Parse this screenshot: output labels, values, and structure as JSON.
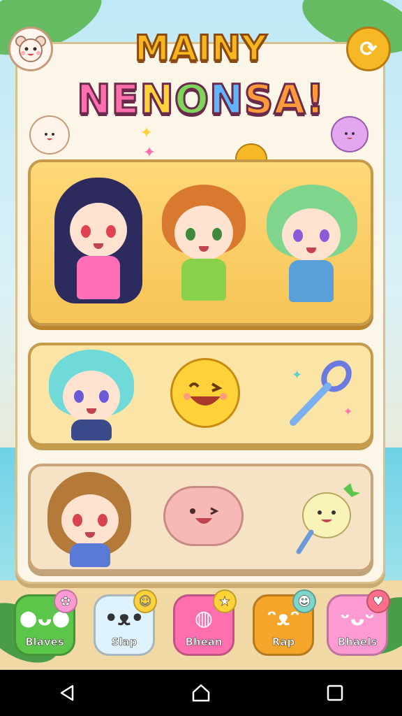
{
  "title": {
    "line1": "MAINY",
    "line2_parts": [
      "NE",
      "N",
      "O",
      "N",
      "SA!"
    ]
  },
  "corner": {
    "left_icon": "bear-face-icon",
    "right_icon": "refresh-icon",
    "right_glyph": "⟳"
  },
  "cards": [
    {
      "name": "character-trio-card",
      "characters": [
        {
          "hair": "#2d2a5e",
          "outfit": "#ff6fb8",
          "eye": "#e0434f"
        },
        {
          "hair": "#d9782f",
          "outfit": "#8ad14b",
          "eye": "#3f8a3a"
        },
        {
          "hair": "#7fd58c",
          "outfit": "#5aa0d8",
          "eye": "#8a5ad8"
        }
      ]
    },
    {
      "name": "character-emoji-card",
      "character": {
        "hair": "#6fdad8",
        "outfit": "#3a4a8a",
        "eye": "#6a5ad8"
      },
      "emoji_icon": "laughing-face-icon",
      "tool_icon": "magic-wand-icon"
    },
    {
      "name": "character-blob-card",
      "character": {
        "hair": "#b57a3a",
        "outfit": "#5a7ad8",
        "eye": "#d8434f"
      },
      "blob_icon": "cloud-face-icon",
      "pet_icon": "radish-pet-icon"
    }
  ],
  "bottom_buttons": [
    {
      "label": "Blaves",
      "color": "#5cc64a",
      "icon": "slime-icon",
      "badge_icon": "flower-icon"
    },
    {
      "label": "Slap",
      "color": "#dff3ff",
      "icon": "cat-icon",
      "badge_icon": "smile-icon"
    },
    {
      "label": "Bhean",
      "color": "#ff6fb0",
      "icon": "potion-icon",
      "badge_icon": "star-icon"
    },
    {
      "label": "Rap",
      "color": "#f5a52a",
      "icon": "fox-icon",
      "badge_icon": "bubble-icon"
    },
    {
      "label": "Bhaels",
      "color": "#ff9ad2",
      "icon": "bunny-icon",
      "badge_icon": "heart-icon"
    }
  ],
  "navbar": {
    "back_icon": "back-triangle-icon",
    "home_icon": "home-icon",
    "recents_icon": "recents-square-icon"
  }
}
